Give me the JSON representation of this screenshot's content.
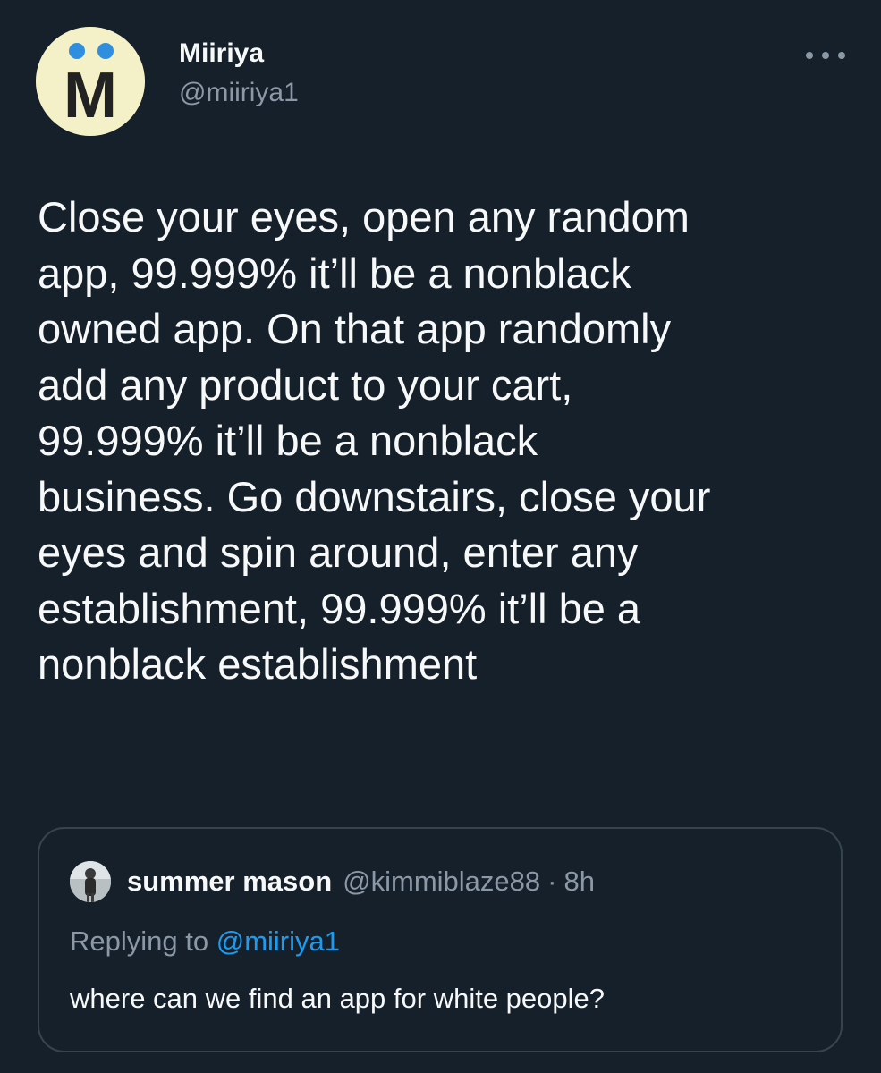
{
  "author": {
    "display_name": "Miiriya",
    "handle": "@miiriya1",
    "avatar_letter": "M",
    "avatar_icon": "m-logo-avatar"
  },
  "more_icon": "more-horizontal-icon",
  "tweet": {
    "text": "Close your eyes, open any random\napp, 99.999% it’ll be a nonblack\nowned app. On that app randomly\nadd any product to your cart,\n99.999% it’ll be a nonblack\nbusiness. Go downstairs, close your\neyes and spin around, enter any\nestablishment, 99.999% it’ll be a\nnonblack establishment"
  },
  "quote": {
    "display_name": "summer mason",
    "handle": "@kimmiblaze88",
    "separator": "·",
    "time": "8h",
    "replying_prefix": "Replying to ",
    "replying_to": "@miiriya1",
    "text": "where can we find an app for white people?"
  },
  "colors": {
    "background": "#15202b",
    "text_primary": "#f7f9f9",
    "text_secondary": "#8b98a5",
    "accent": "#1d9bf0",
    "border": "#38444d",
    "avatar_bg": "#f4f0c8",
    "avatar_dots": "#2f8fde"
  }
}
